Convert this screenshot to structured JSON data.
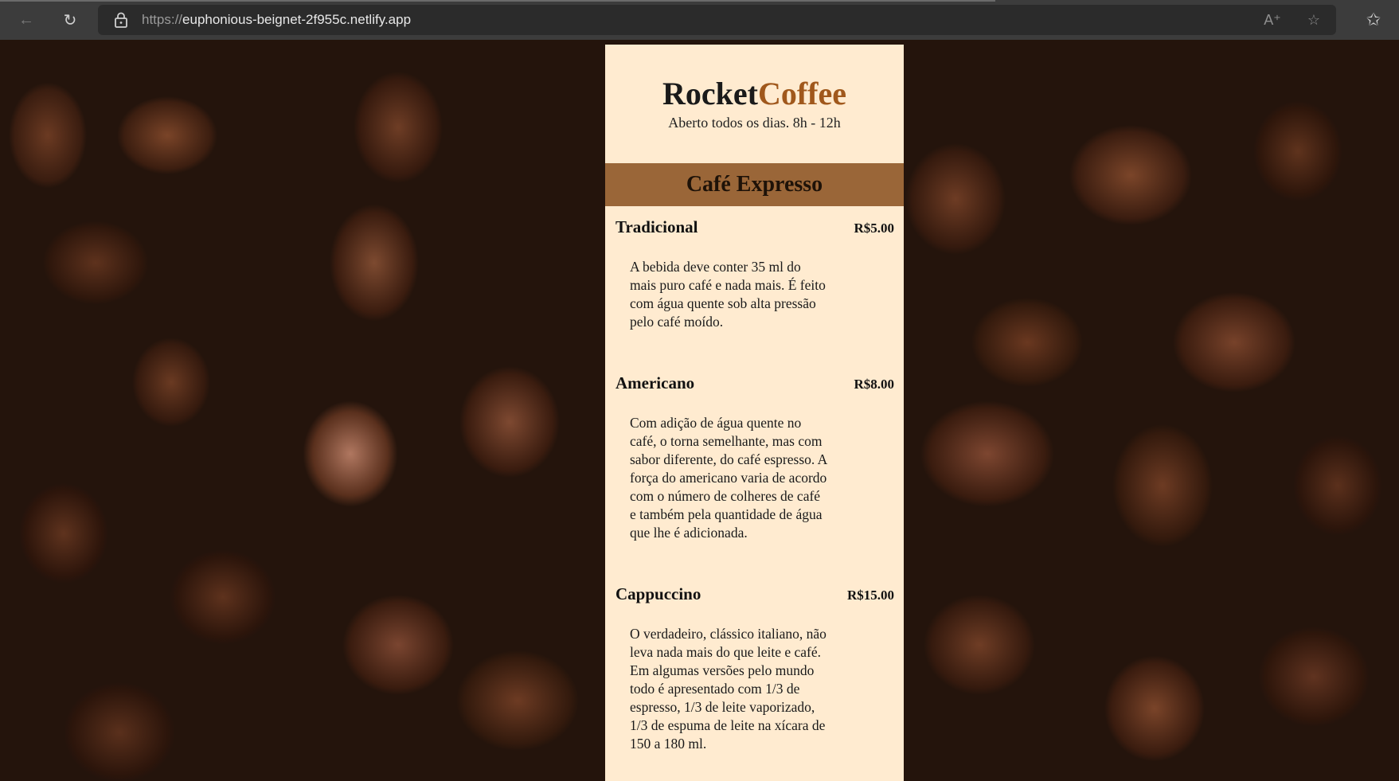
{
  "browser": {
    "url_protocol": "https://",
    "url_host": "euphonious-beignet-2f955c.netlify.app",
    "icons": [
      "back-icon",
      "reload-icon",
      "lock-icon",
      "read-aloud-icon",
      "add-favorite-icon",
      "favorites-icon"
    ]
  },
  "menu": {
    "brand_part1": "Rocket",
    "brand_part2": "Coffee",
    "hours": "Aberto todos os dias. 8h - 12h",
    "section_title": "Café Expresso",
    "items": [
      {
        "name": "Tradicional",
        "price": "R$5.00",
        "description": "A bebida deve conter 35 ml do mais puro café e nada mais. É feito com água quente sob alta pressão pelo café moído."
      },
      {
        "name": "Americano",
        "price": "R$8.00",
        "description": "Com adição de água quente no café, o torna semelhante, mas com sabor diferente, do café espresso. A força do americano varia de acordo com o número de colheres de café e também pela quantidade de água que lhe é adicionada."
      },
      {
        "name": "Cappuccino",
        "price": "R$15.00",
        "description": "O verdadeiro, clássico italiano, não leva nada mais do que leite e café. Em algumas versões pelo mundo todo é apresentado com 1/3 de espresso, 1/3 de leite vaporizado, 1/3 de espuma de leite na xícara de 150 a 180 ml."
      }
    ]
  },
  "colors": {
    "panel_bg": "#ffebd0",
    "section_header_bg": "#9a6638",
    "brand_accent": "#a0581c"
  }
}
